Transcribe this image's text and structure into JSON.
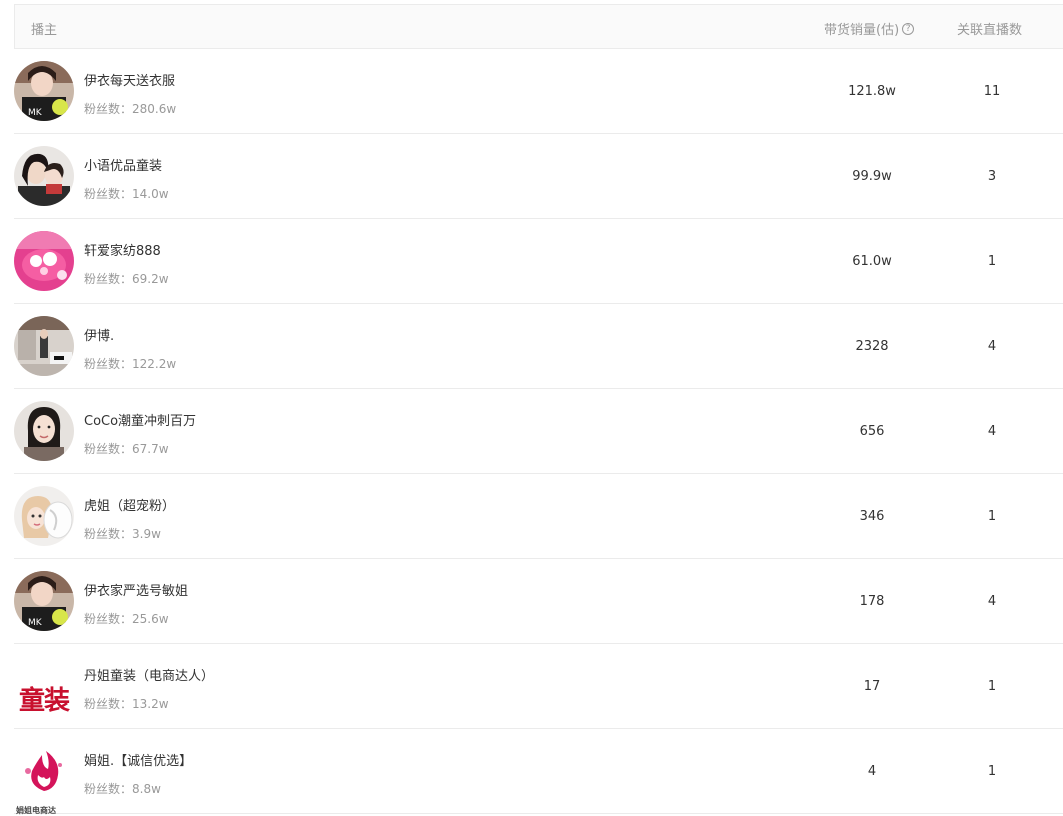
{
  "header": {
    "anchor_label": "播主",
    "sales_label": "带货销量(估)",
    "help_glyph": "?",
    "live_label": "关联直播数"
  },
  "rows": [
    {
      "name": "伊衣每天送衣服",
      "fans": "粉丝数：280.6w",
      "sales": "121.8w",
      "live": "11",
      "avatar": "photo-woman"
    },
    {
      "name": "小语优品童装",
      "fans": "粉丝数：14.0w",
      "sales": "99.9w",
      "live": "3",
      "avatar": "photo-mother-child"
    },
    {
      "name": "轩爱家纺888",
      "fans": "粉丝数：69.2w",
      "sales": "61.0w",
      "live": "1",
      "avatar": "photo-pink-bedding"
    },
    {
      "name": "伊博.",
      "fans": "粉丝数：122.2w",
      "sales": "2328",
      "live": "4",
      "avatar": "photo-room"
    },
    {
      "name": "CoCo潮童冲刺百万",
      "fans": "粉丝数：67.7w",
      "sales": "656",
      "live": "4",
      "avatar": "photo-woman-portrait"
    },
    {
      "name": "虎姐（超宠粉）",
      "fans": "粉丝数：3.9w",
      "sales": "346",
      "live": "1",
      "avatar": "photo-doll"
    },
    {
      "name": "伊衣家严选号敏姐",
      "fans": "粉丝数：25.6w",
      "sales": "178",
      "live": "4",
      "avatar": "photo-woman"
    },
    {
      "name": "丹姐童装（电商达人）",
      "fans": "粉丝数：13.2w",
      "sales": "17",
      "live": "1",
      "avatar": "logo-text",
      "logo_text": "童装"
    },
    {
      "name": "娟姐.【诚信优选】",
      "fans": "粉丝数：8.8w",
      "sales": "4",
      "live": "1",
      "avatar": "logo-flame",
      "logo_text": "娟姐电商达"
    }
  ],
  "colors": {
    "border": "#ebebeb",
    "header_bg": "#fafafa",
    "muted_text": "#999999",
    "logo_red": "#c8102e",
    "logo_magenta": "#d4145a"
  }
}
